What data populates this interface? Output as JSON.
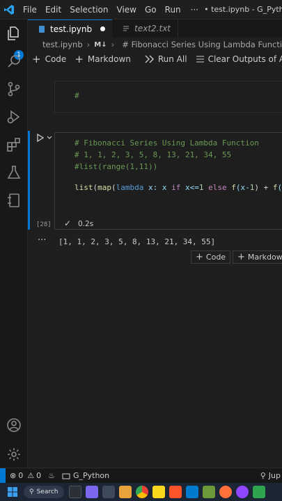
{
  "titlebar": {
    "menu": [
      "File",
      "Edit",
      "Selection",
      "View",
      "Go",
      "Run"
    ],
    "more": "···",
    "title": "• test.ipynb - G_Pyth"
  },
  "activitybar": {
    "badge": "1"
  },
  "tabs": [
    {
      "label": "test.ipynb",
      "active": true,
      "dirty": true
    },
    {
      "label": "text2.txt",
      "active": false
    }
  ],
  "breadcrumb": {
    "file": "test.ipynb",
    "md": "M↓",
    "section": "# Fibonacci Series Using Lambda Function"
  },
  "toolbar": {
    "code": "Code",
    "markdown": "Markdown",
    "run_all": "Run All",
    "clear_outputs": "Clear Outputs of All Cells"
  },
  "cell1": {
    "code": "#"
  },
  "cell2": {
    "line1": "# Fibonacci Series Using Lambda Function",
    "line2": "# 1, 1, 2, 3, 5, 8, 13, 21, 34, 55",
    "line3": "#list(range(1,11))",
    "line4_parts": [
      "list",
      "(",
      "map",
      "(",
      "lambda",
      " x: x ",
      "if",
      " x<=",
      "1",
      " ",
      "else",
      " ",
      "f",
      "(x-",
      "1",
      ") + ",
      "f",
      "(x"
    ],
    "exec_count": "[28]",
    "exec_time": "0.2s",
    "output_dots": "···",
    "output": "[1, 1, 2, 3, 5, 8, 13, 21, 34, 55]"
  },
  "add_cell": {
    "code": "Code",
    "markdown": "Markdown"
  },
  "statusbar": {
    "errors": "0",
    "warnings": "0",
    "branch": "G_Python",
    "right": "Jup"
  },
  "taskbar": {
    "search": "Search"
  },
  "colors": {
    "accent": "#0078d4",
    "background": "#1e1e1e",
    "comment": "#6a9955"
  }
}
